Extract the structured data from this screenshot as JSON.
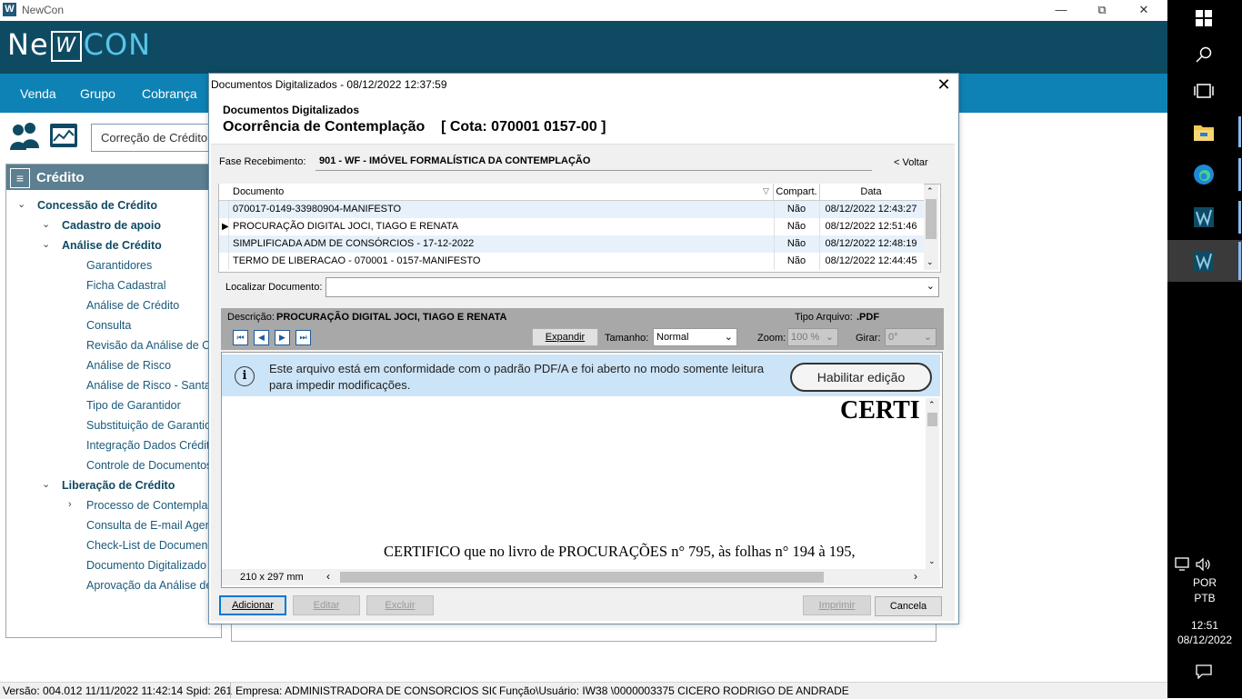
{
  "window": {
    "title": "NewCon",
    "minimize": "—",
    "maximize": "⧉",
    "close": "✕"
  },
  "logo": {
    "part1": "Ne",
    "mark": "W",
    "part2": "CON"
  },
  "menu": {
    "items": [
      "Venda",
      "Grupo",
      "Cobrança"
    ]
  },
  "toolbar": {
    "search_text": "Correção de Crédito"
  },
  "sidebar": {
    "title": "Crédito",
    "tree": [
      {
        "label": "Concessão de Crédito",
        "chev": "⌄"
      },
      {
        "label": "Cadastro de apoio",
        "chev": "⌄"
      },
      {
        "label": "Análise de Crédito",
        "chev": "⌄"
      },
      {
        "label": "Garantidores"
      },
      {
        "label": "Ficha Cadastral"
      },
      {
        "label": "Análise de Crédito"
      },
      {
        "label": "Consulta"
      },
      {
        "label": "Revisão da Análise de C"
      },
      {
        "label": "Análise de Risco"
      },
      {
        "label": "Análise de Risco - Santa"
      },
      {
        "label": "Tipo de Garantidor"
      },
      {
        "label": "Substituição de Garantic"
      },
      {
        "label": "Integração Dados Crédit"
      },
      {
        "label": "Controle de Documentos"
      },
      {
        "label": "Liberação de Crédito",
        "chev": "⌄"
      },
      {
        "label": "Processo de Contempla",
        "chev": "›"
      },
      {
        "label": "Consulta de E-mail Agen"
      },
      {
        "label": "Check-List de Documen"
      },
      {
        "label": "Documento Digitalizado"
      },
      {
        "label": "Aprovação da Análise de"
      }
    ]
  },
  "status": {
    "version": "Versão: 004.012  11/11/2022 11:42:14  Spid: 261",
    "company": "Empresa: ADMINISTRADORA DE CONSORCIOS SICREI",
    "user": "Função\\Usuário: IW38  \\0000003375 CICERO RODRIGO DE ANDRADE"
  },
  "taskbar": {
    "lang1": "POR",
    "lang2": "PTB",
    "time": "12:51",
    "date": "08/12/2022"
  },
  "dialog": {
    "title": "Documentos Digitalizados - 08/12/2022  12:37:59",
    "close": "✕",
    "subtitle": "Documentos Digitalizados",
    "heading": "Ocorrência de Contemplação    [ Cota: 070001 0157-00 ]",
    "fase_label": "Fase Recebimento:",
    "fase_value": "901 - WF - IMÓVEL FORMALÍSTICA DA CONTEMPLAÇÃO",
    "voltar": "< Voltar",
    "grid": {
      "headers": [
        "Documento",
        "Compart.",
        "Data"
      ],
      "rows": [
        {
          "doc": "070017-0149-33980904-MANIFESTO",
          "comp": "Não",
          "data": "08/12/2022 12:43:27"
        },
        {
          "doc": "PROCURAÇÃO DIGITAL JOCI, TIAGO E RENATA",
          "comp": "Não",
          "data": "08/12/2022 12:51:46"
        },
        {
          "doc": "SIMPLIFICADA ADM DE CONSÓRCIOS - 17-12-2022",
          "comp": "Não",
          "data": "08/12/2022 12:48:19"
        },
        {
          "doc": "TERMO DE LIBERACAO - 070001 - 0157-MANIFESTO",
          "comp": "Não",
          "data": "08/12/2022 12:44:45"
        }
      ]
    },
    "localizar_label": "Localizar Documento:",
    "descricao_label": "Descrição:",
    "descricao_value": "PROCURAÇÃO DIGITAL JOCI, TIAGO E RENATA",
    "tipo_label": "Tipo Arquivo:",
    "tipo_value": ".PDF",
    "expandir": "Expandir",
    "tamanho_label": "Tamanho:",
    "tamanho_value": "Normal",
    "zoom_label": "Zoom:",
    "zoom_value": "100 %",
    "girar_label": "Girar:",
    "girar_value": "0°",
    "pdf": {
      "info": "Este arquivo está em conformidade com o padrão PDF/A e foi aberto no modo somente leitura para impedir modificações.",
      "enable_button": "Habilitar edição",
      "heading": "CERTI",
      "body": "CERTIFICO que no livro de PROCURAÇÕES n° 795, às folhas n° 194 à 195,",
      "page_size": "210 x 297 mm"
    },
    "buttons": {
      "adicionar": "Adicionar",
      "editar": "Editar",
      "excluir": "Excluir",
      "imprimir": "Imprimir",
      "cancela": "Cancela"
    }
  }
}
